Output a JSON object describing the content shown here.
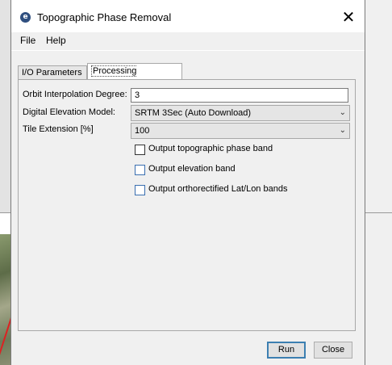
{
  "window": {
    "title": "Topographic Phase Removal",
    "app_icon_glyph": "e",
    "close_glyph": "✕"
  },
  "menu": {
    "items": [
      "File",
      "Help"
    ]
  },
  "tabs": [
    {
      "label": "I/O Parameters",
      "active": false
    },
    {
      "label": "Processing Parameters",
      "active": true
    }
  ],
  "form": {
    "orbit_label": "Orbit Interpolation Degree:",
    "orbit_value": "3",
    "dem_label": "Digital Elevation Model:",
    "dem_selected": "SRTM 3Sec (Auto Download)",
    "tile_label": "Tile Extension [%]",
    "tile_selected": "100",
    "checkboxes": [
      {
        "label": "Output topographic phase band",
        "checked": false
      },
      {
        "label": "Output elevation band",
        "checked": false
      },
      {
        "label": "Output orthorectified Lat/Lon bands",
        "checked": false
      }
    ]
  },
  "buttons": {
    "run": "Run",
    "close": "Close"
  },
  "icons": {
    "dropdown": "chevron-down-icon",
    "app": "snap-logo-icon",
    "close": "close-icon"
  }
}
